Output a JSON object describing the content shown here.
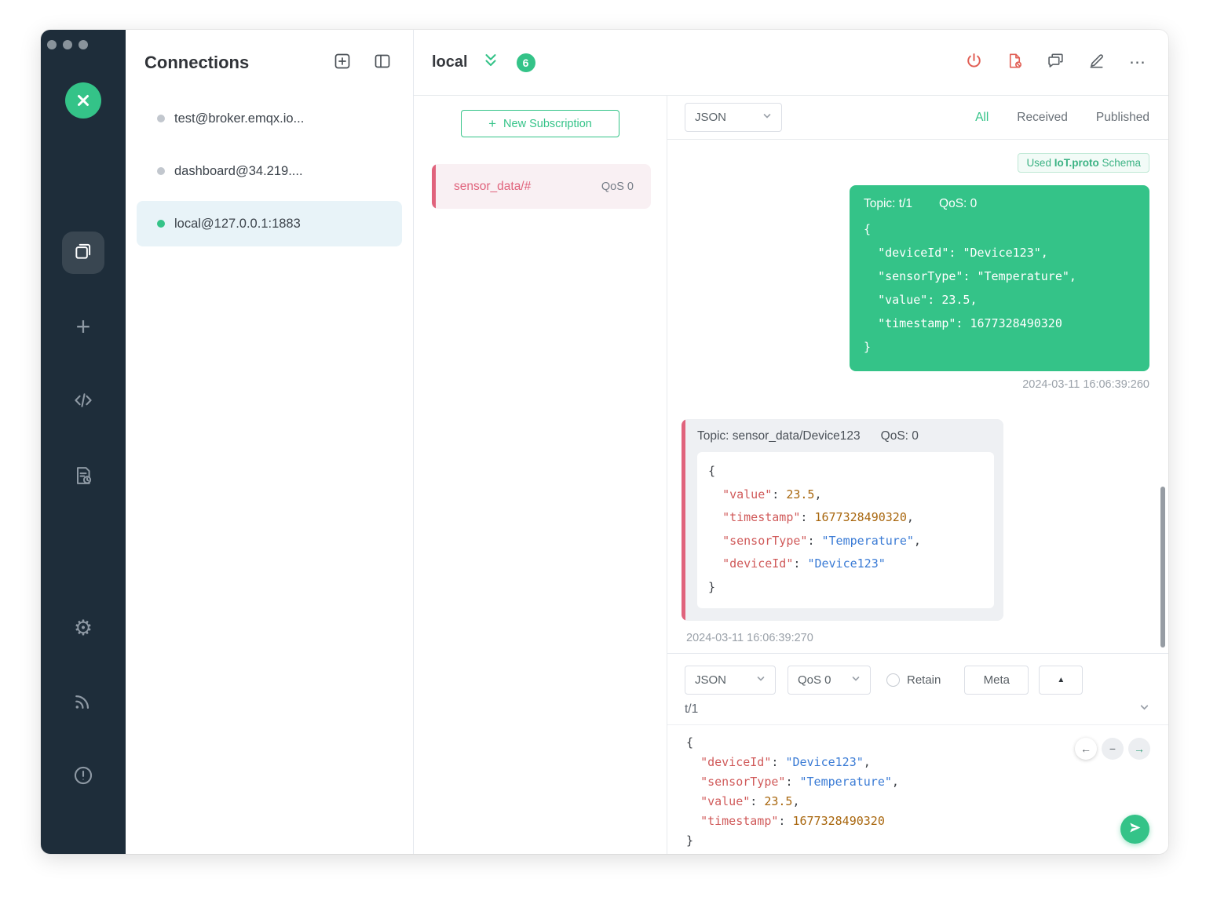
{
  "colors": {
    "accent_green": "#34c388",
    "topic_pink": "#e0637c",
    "danger_red": "#e15f55"
  },
  "icons": {
    "plus": "+",
    "more": "⋯",
    "gear": "⚙",
    "collapse_arrow": "▲",
    "nav_back": "←",
    "nav_remove": "−",
    "nav_forward": "→"
  },
  "connections": {
    "title": "Connections",
    "items": [
      {
        "label": "test@broker.emqx.io...",
        "status": "offline",
        "active": false
      },
      {
        "label": "dashboard@34.219....",
        "status": "offline",
        "active": false
      },
      {
        "label": "local@127.0.0.1:1883",
        "status": "online",
        "active": true
      }
    ]
  },
  "header": {
    "connection_name": "local",
    "message_count": "6"
  },
  "subscriptions": {
    "new_label": "New Subscription",
    "items": [
      {
        "topic": "sensor_data/#",
        "qos": "QoS 0"
      }
    ]
  },
  "messages": {
    "format_selector": "JSON",
    "filters": [
      {
        "label": "All",
        "active": true
      },
      {
        "label": "Received",
        "active": false
      },
      {
        "label": "Published",
        "active": false
      }
    ],
    "schema_badge": {
      "prefix": "Used ",
      "name": "IoT.proto",
      "suffix": " Schema"
    },
    "published": {
      "topic_label": "Topic: t/1",
      "qos_label": "QoS: 0",
      "timestamp": "2024-03-11 16:06:39:260",
      "payload": [
        {
          "key": "deviceId",
          "value": "Device123",
          "vtype": "string"
        },
        {
          "key": "sensorType",
          "value": "Temperature",
          "vtype": "string"
        },
        {
          "key": "value",
          "value": "23.5",
          "vtype": "number"
        },
        {
          "key": "timestamp",
          "value": "1677328490320",
          "vtype": "number"
        }
      ]
    },
    "received": {
      "topic_label": "Topic: sensor_data/Device123",
      "qos_label": "QoS: 0",
      "timestamp": "2024-03-11 16:06:39:270",
      "payload": [
        {
          "key": "value",
          "value": "23.5",
          "vtype": "number"
        },
        {
          "key": "timestamp",
          "value": "1677328490320",
          "vtype": "number"
        },
        {
          "key": "sensorType",
          "value": "Temperature",
          "vtype": "string"
        },
        {
          "key": "deviceId",
          "value": "Device123",
          "vtype": "string"
        }
      ]
    }
  },
  "publish": {
    "format_selector": "JSON",
    "qos_selector": "QoS 0",
    "retain_label": "Retain",
    "meta_label": "Meta",
    "topic_input": "t/1",
    "payload": [
      {
        "key": "deviceId",
        "value": "Device123",
        "vtype": "string"
      },
      {
        "key": "sensorType",
        "value": "Temperature",
        "vtype": "string"
      },
      {
        "key": "value",
        "value": "23.5",
        "vtype": "number"
      },
      {
        "key": "timestamp",
        "value": "1677328490320",
        "vtype": "number"
      }
    ]
  }
}
